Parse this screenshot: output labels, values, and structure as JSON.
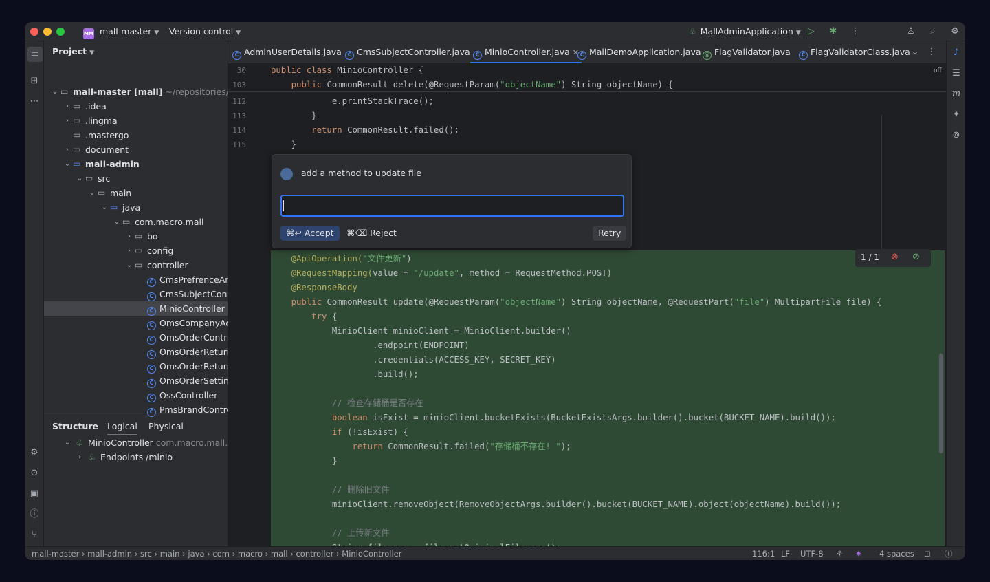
{
  "titlebar": {
    "project_badge": "MM",
    "project": "mall-master",
    "vcs": "Version control",
    "run_config": "MallAdminApplication"
  },
  "project_panel": {
    "title": "Project",
    "root_name": "mall-master",
    "root_module": "[mall]",
    "root_path": "~/repositories/test",
    "items": [
      {
        "label": "mall-master [mall]"
      },
      {
        "label": ".idea"
      },
      {
        "label": ".lingma"
      },
      {
        "label": ".mastergo"
      },
      {
        "label": "document"
      },
      {
        "label": "mall-admin"
      },
      {
        "label": "src"
      },
      {
        "label": "main"
      },
      {
        "label": "java"
      },
      {
        "label": "com.macro.mall"
      },
      {
        "label": "bo"
      },
      {
        "label": "config"
      },
      {
        "label": "controller"
      },
      {
        "label": "CmsPrefrenceAreaController"
      },
      {
        "label": "CmsSubjectController"
      },
      {
        "label": "MinioController"
      },
      {
        "label": "OmsCompanyAddressController"
      },
      {
        "label": "OmsOrderController"
      },
      {
        "label": "OmsOrderReturnApplyController"
      },
      {
        "label": "OmsOrderReturnReasonController"
      },
      {
        "label": "OmsOrderSettingController"
      },
      {
        "label": "OssController"
      },
      {
        "label": "PmsBrandController"
      }
    ]
  },
  "structure": {
    "tabs": [
      "Structure",
      "Logical",
      "Physical"
    ],
    "class_name": "MinioController",
    "class_pkg": "com.macro.mall.controller",
    "endpoints_label": "Endpoints",
    "endpoints_path": "/minio"
  },
  "tabs": [
    {
      "label": "AdminUserDetails.java"
    },
    {
      "label": "CmsSubjectController.java"
    },
    {
      "label": "MinioController.java"
    },
    {
      "label": "MallDemoApplication.java"
    },
    {
      "label": "FlagValidator.java"
    },
    {
      "label": "FlagValidatorClass.java"
    }
  ],
  "editor": {
    "off_label": "off",
    "sticky": [
      {
        "ln": "30",
        "pre": "",
        "kw": "public class ",
        "rest": "MinioController {"
      },
      {
        "ln": "103",
        "pre": "    ",
        "kw": "public ",
        "rest": "CommonResult delete(@RequestParam(",
        "str": "\"objectName\"",
        "tail": ") String objectName) {"
      }
    ],
    "lines": [
      {
        "ln": "112",
        "text": "            e.printStackTrace();"
      },
      {
        "ln": "113",
        "text": "        }"
      },
      {
        "ln": "114",
        "kw": "        return ",
        "text": "CommonResult.failed();"
      },
      {
        "ln": "115",
        "text": "    }"
      }
    ],
    "diff_counter": "1 / 1"
  },
  "ai_popup": {
    "prompt": "add a method to update file",
    "input_value": "",
    "accept": "⌘↩ Accept",
    "reject": "⌘⌫ Reject",
    "retry": "Retry"
  },
  "generated": [
    {
      "pre": "    ",
      "an": "@ApiOperation(",
      "str": "\"文件更新\"",
      "rest": ")"
    },
    {
      "pre": "    ",
      "an": "@RequestMapping(",
      "rest": "value = ",
      "str": "\"/update\"",
      "tail": ", method = RequestMethod.POST)"
    },
    {
      "pre": "    ",
      "an": "@ResponseBody"
    },
    {
      "pre": "    ",
      "kw": "public ",
      "rest": "CommonResult update(@RequestParam(",
      "str": "\"objectName\"",
      "tail": ") String objectName, @RequestPart(",
      "str2": "\"file\"",
      "tail2": ") MultipartFile file) {"
    },
    {
      "pre": "        ",
      "kw": "try ",
      "rest": "{"
    },
    {
      "pre": "            ",
      "rest": "MinioClient minioClient = MinioClient.builder()"
    },
    {
      "pre": "                    ",
      "rest": ".endpoint(ENDPOINT)"
    },
    {
      "pre": "                    ",
      "rest": ".credentials(ACCESS_KEY, SECRET_KEY)"
    },
    {
      "pre": "                    ",
      "rest": ".build();"
    },
    {
      "pre": "",
      "rest": ""
    },
    {
      "pre": "            ",
      "cm": "// 检查存储桶是否存在"
    },
    {
      "pre": "            ",
      "kw": "boolean ",
      "rest": "isExist = minioClient.bucketExists(BucketExistsArgs.builder().bucket(BUCKET_NAME).build());"
    },
    {
      "pre": "            ",
      "kw": "if ",
      "rest": "(!isExist) {"
    },
    {
      "pre": "                ",
      "kw": "return ",
      "rest": "CommonResult.failed(",
      "str": "\"存储桶不存在! \"",
      "tail": ");"
    },
    {
      "pre": "            ",
      "rest": "}"
    },
    {
      "pre": "",
      "rest": ""
    },
    {
      "pre": "            ",
      "cm": "// 删除旧文件"
    },
    {
      "pre": "            ",
      "rest": "minioClient.removeObject(RemoveObjectArgs.builder().bucket(BUCKET_NAME).object(objectName).build());"
    },
    {
      "pre": "",
      "rest": ""
    },
    {
      "pre": "            ",
      "cm": "// 上传新文件"
    },
    {
      "pre": "            ",
      "rest": "String filename = file.getOriginalFilename();"
    }
  ],
  "statusbar": {
    "breadcrumbs": [
      "mall-master",
      "mall-admin",
      "src",
      "main",
      "java",
      "com",
      "macro",
      "mall",
      "controller",
      "MinioController"
    ],
    "position": "116:1",
    "line_sep": "LF",
    "encoding": "UTF-8",
    "indent": "4 spaces"
  },
  "colors": {
    "accent": "#3574f0",
    "diff_bg": "#2f4a34",
    "panel": "#2b2d30",
    "editor": "#1e1f22"
  }
}
